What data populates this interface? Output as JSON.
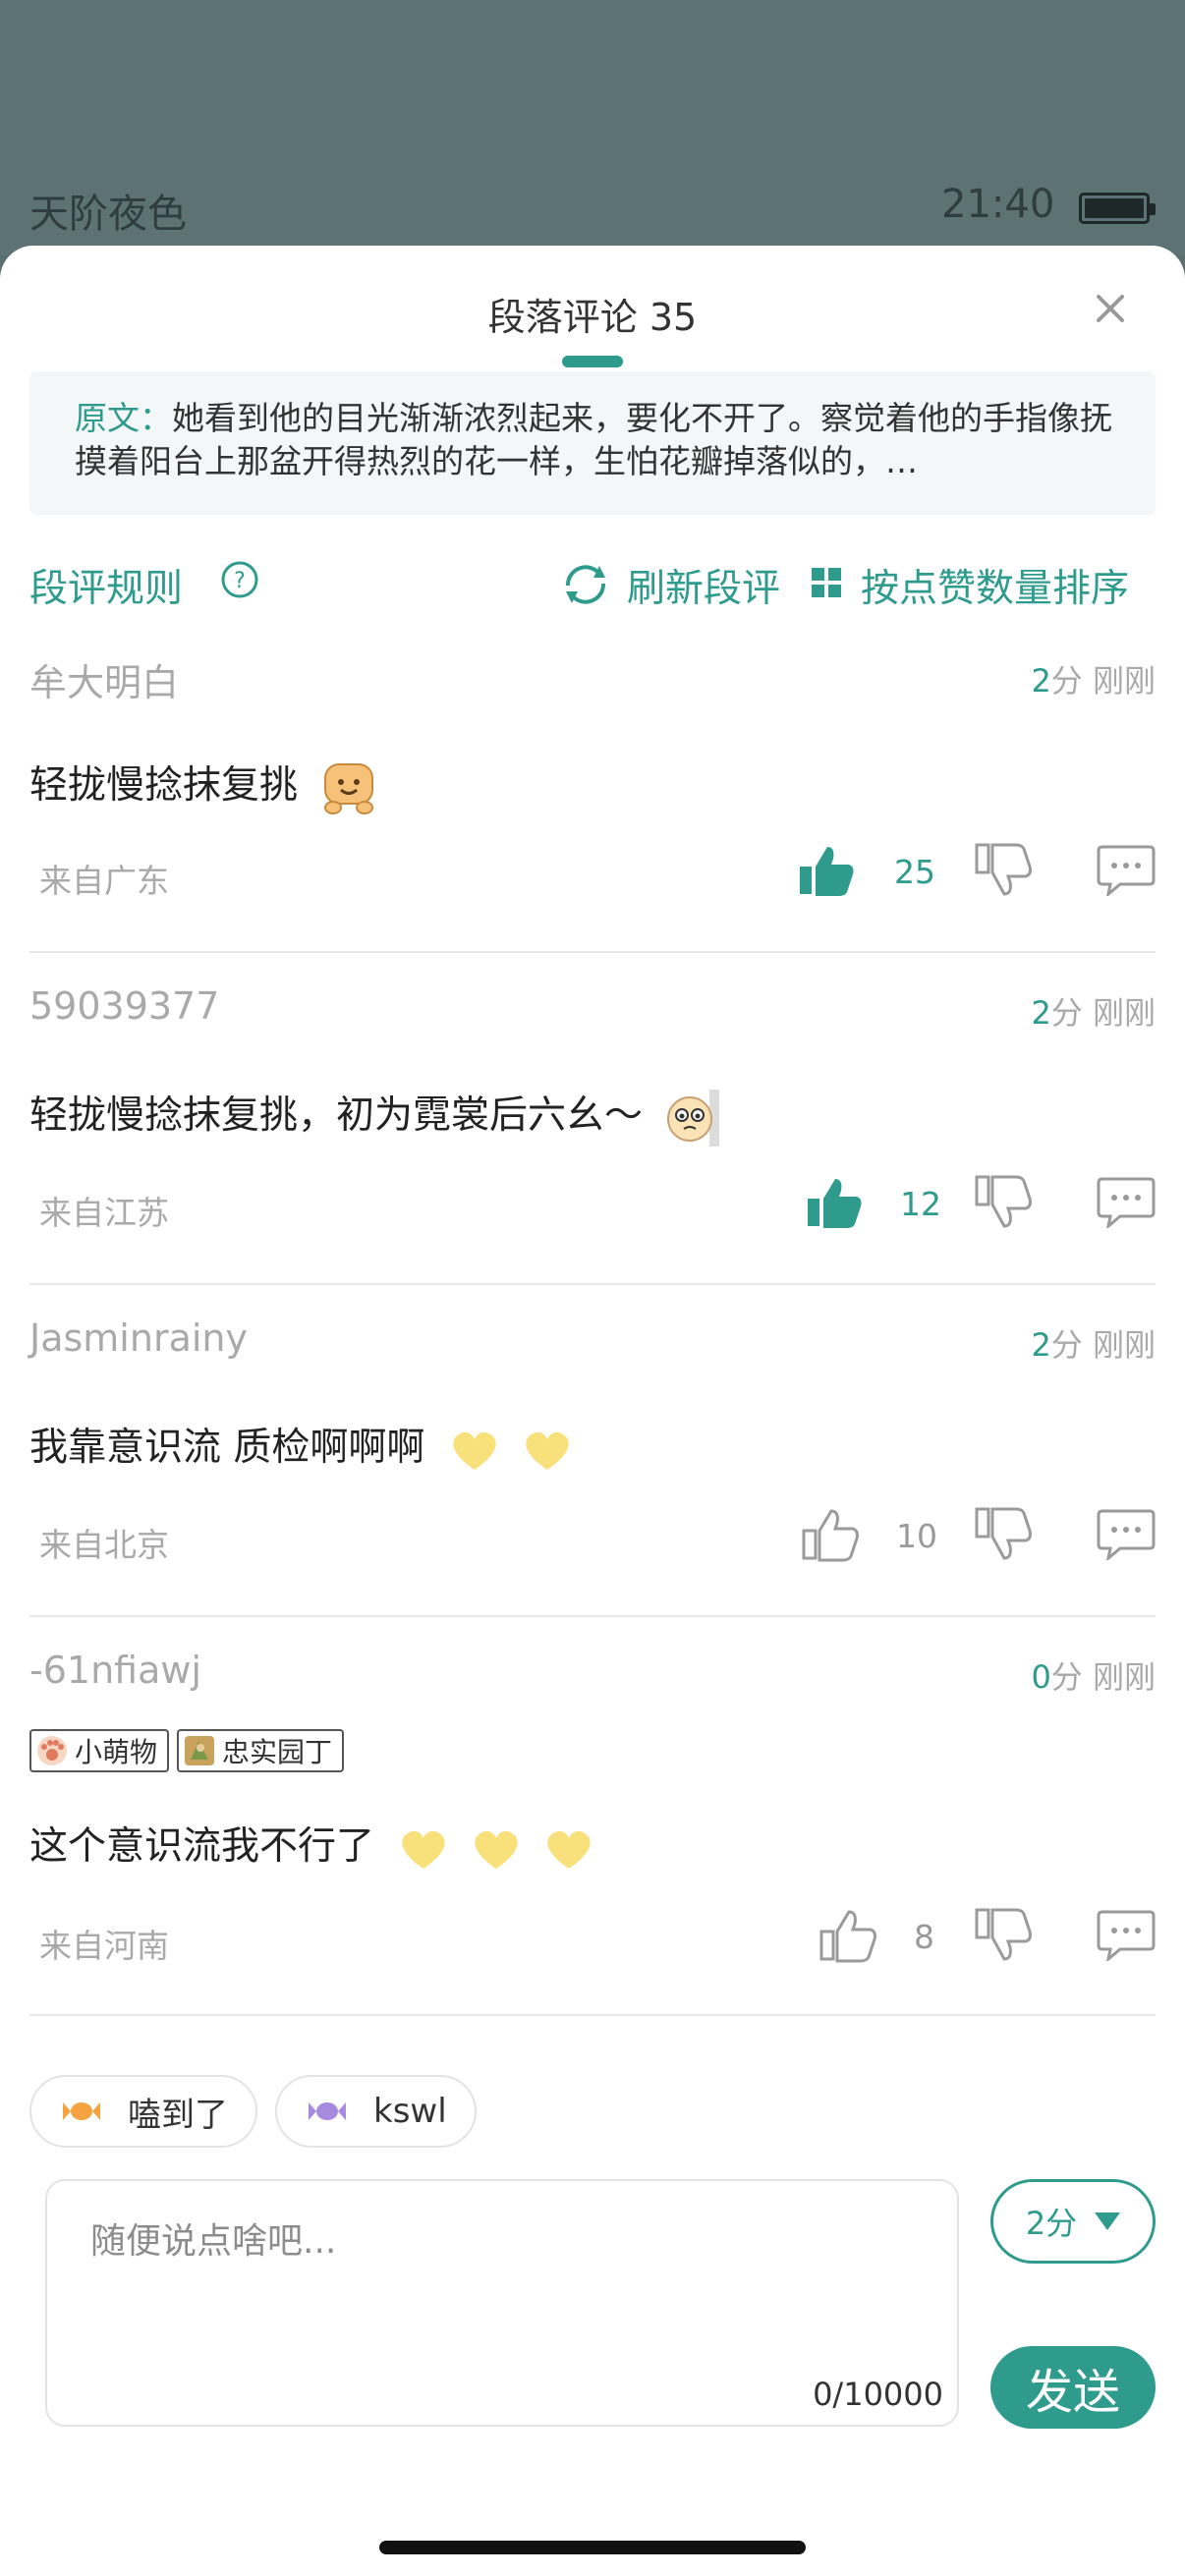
{
  "reader": {
    "book_title": "天阶夜色",
    "time": "21:40"
  },
  "sheet": {
    "title": "段落评论  35",
    "quote_label": "原文：",
    "quote_text": "她看到他的目光渐渐浓烈起来，要化不开了。察觉着他的手指像抚摸着阳台上那盆开得热烈的花一样，生怕花瓣掉落似的，…"
  },
  "toolbar": {
    "rules": "段评规则",
    "refresh": "刷新段评",
    "sort": "按点赞数量排序"
  },
  "comments": [
    {
      "user": "牟大明白",
      "score": "2",
      "score_unit": "分",
      "time": "刚刚",
      "text": "轻拢慢捻抹复挑",
      "location": "来自广东",
      "likes": "25",
      "liked": true,
      "emoji": "smile-bear"
    },
    {
      "user": "59039377",
      "score": "2",
      "score_unit": "分",
      "time": "刚刚",
      "text": "轻拢慢捻抹复挑，初为霓裳后六幺～",
      "location": "来自江苏",
      "likes": "12",
      "liked": true,
      "emoji": "teary-face"
    },
    {
      "user": "Jasminrainy",
      "score": "2",
      "score_unit": "分",
      "time": "刚刚",
      "text": "我靠意识流 质检啊啊啊",
      "location": "来自北京",
      "likes": "10",
      "liked": false,
      "emoji": "yellow-hearts-2"
    },
    {
      "user": "-61nfiawj",
      "score": "0",
      "score_unit": "分",
      "time": "刚刚",
      "text": "这个意识流我不行了",
      "location": "来自河南",
      "likes": "8",
      "liked": false,
      "emoji": "yellow-hearts-3",
      "badges": [
        "小萌物",
        "忠实园丁"
      ]
    }
  ],
  "quick_replies": [
    {
      "label": "嗑到了",
      "icon": "candy-orange-icon"
    },
    {
      "label": "kswl",
      "icon": "candy-purple-icon"
    }
  ],
  "input": {
    "placeholder": "随便说点啥吧...",
    "char_count": "0/10000",
    "score_select": "2分",
    "send": "发送"
  },
  "colors": {
    "accent": "#2e9b8c",
    "muted_text": "#a9a9a9",
    "heart_yellow": "#f8e07a"
  }
}
